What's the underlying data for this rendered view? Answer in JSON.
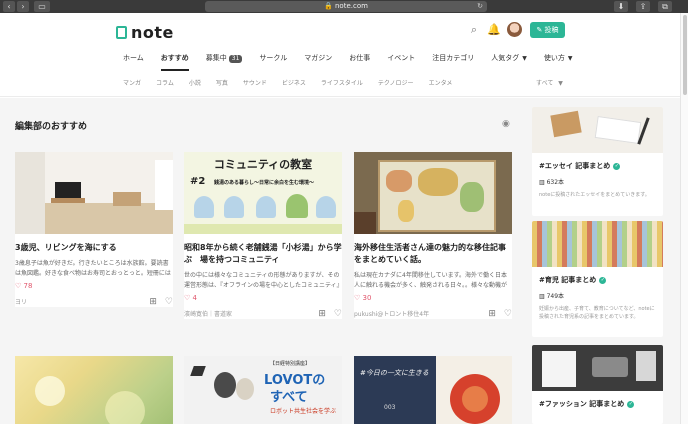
{
  "browser": {
    "url": "note.com"
  },
  "header": {
    "logo_text": "note",
    "post_label": "投稿",
    "nav": [
      {
        "label": "ホーム"
      },
      {
        "label": "おすすめ",
        "active": true
      },
      {
        "label": "募集中",
        "badge": "31"
      },
      {
        "label": "サークル"
      },
      {
        "label": "マガジン"
      },
      {
        "label": "お仕事"
      },
      {
        "label": "イベント"
      },
      {
        "label": "注目カテゴリ"
      },
      {
        "label": "人気タグ"
      },
      {
        "label": "使い方"
      }
    ],
    "subnav": [
      "マンガ",
      "コラム",
      "小説",
      "写真",
      "サウンド",
      "ビジネス",
      "ライフスタイル",
      "テクノロジー",
      "エンタメ"
    ],
    "sort_label": "すべて"
  },
  "feed": {
    "section_title": "編集部のおすすめ",
    "cards": [
      {
        "title": "3歳児、リビングを海にする",
        "excerpt": "3歳息子は魚が好きだ。行きたいところは水族館。要読書は魚図鑑。好きな食べ物はお寿司とおっとっと。短冊には「さかなのオモチャがほしいです」と書…",
        "likes": "78",
        "author": "ヨリ"
      },
      {
        "title": "昭和8年から続く老舗銭湯「小杉湯」から学ぶ　場を持つコミュニティ",
        "excerpt": "世の中には様々なコミュニティの形態がありますが、その運営形態は、『オフラインの場を中心としたコミュニティ』とFacebookグループなどを活用した『オ…",
        "likes": "4",
        "author": "濱崎寛伯｜書道家",
        "thumb_heading": "コミュニティの教室",
        "thumb_num": "#2",
        "thumb_sub": "銭湯のある暮らし〜日常に余白を生む環境〜"
      },
      {
        "title": "海外移住生活者さん達の魅力的な移住記事をまとめていく話。",
        "excerpt": "私は現在カナダに4年間移住しています。海外で働く日本人に触れる機会が多く、触発される日々。。様々な動機がある移住を知ると、勇気がわいてきませんか？ 海外…",
        "likes": "30",
        "author": "pukushi@トロント移住4年"
      },
      {
        "title": "",
        "excerpt": "",
        "likes": "",
        "author": ""
      },
      {
        "title": "",
        "excerpt": "",
        "likes": "",
        "author": "",
        "thumb_kicker": "【日経特別講座】",
        "thumb_heading": "LOVOTの",
        "thumb_heading2": "すべて",
        "thumb_sub": "ロボット共生社会を学ぶ"
      },
      {
        "title": "",
        "excerpt": "",
        "likes": "",
        "author": "",
        "thumb_text": "#今日の一文に生きる",
        "thumb_num": "003"
      }
    ]
  },
  "sidebar": {
    "items": [
      {
        "title": "#エッセイ 記事まとめ",
        "count": "632本",
        "desc": "noteに投稿されたエッセイをまとめていきます。"
      },
      {
        "title": "#育児 記事まとめ",
        "count": "749本",
        "desc": "妊娠から出産、子育て、教育についてなど、noteに投稿された育児系の記事をまとめています。"
      },
      {
        "title": "#ファッション 記事まとめ",
        "count": "",
        "desc": ""
      }
    ]
  },
  "colors": {
    "brand": "#2cb696",
    "like": "#e0566c"
  }
}
